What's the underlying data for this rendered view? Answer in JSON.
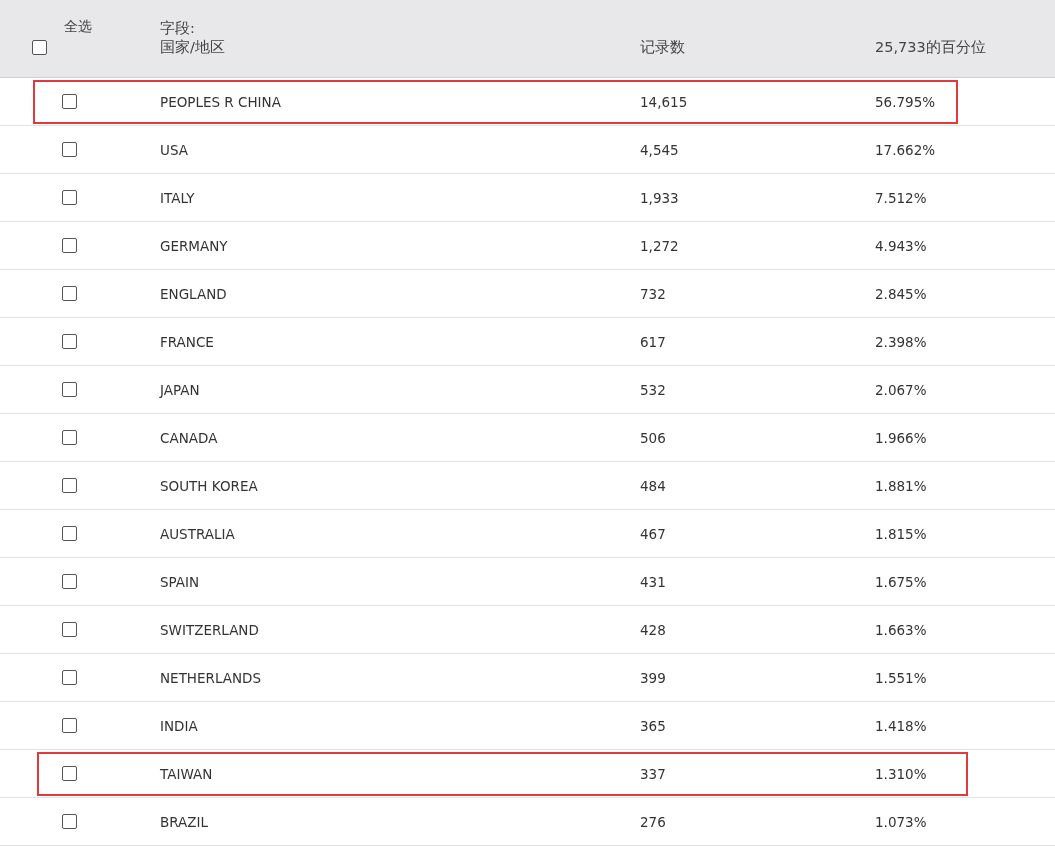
{
  "header": {
    "select_all": {
      "label": "全选",
      "checked": false
    },
    "field_label": "字段:",
    "columns": [
      "国家/地区",
      "记录数",
      "25,733的百分位"
    ]
  },
  "rows": [
    {
      "country": "PEOPLES R CHINA",
      "records": "14,615",
      "percent": "56.795%",
      "checked": false,
      "highlighted": true
    },
    {
      "country": "USA",
      "records": "4,545",
      "percent": "17.662%",
      "checked": false,
      "highlighted": false
    },
    {
      "country": "ITALY",
      "records": "1,933",
      "percent": "7.512%",
      "checked": false,
      "highlighted": false
    },
    {
      "country": "GERMANY",
      "records": "1,272",
      "percent": "4.943%",
      "checked": false,
      "highlighted": false
    },
    {
      "country": "ENGLAND",
      "records": "732",
      "percent": "2.845%",
      "checked": false,
      "highlighted": false
    },
    {
      "country": "FRANCE",
      "records": "617",
      "percent": "2.398%",
      "checked": false,
      "highlighted": false
    },
    {
      "country": "JAPAN",
      "records": "532",
      "percent": "2.067%",
      "checked": false,
      "highlighted": false
    },
    {
      "country": "CANADA",
      "records": "506",
      "percent": "1.966%",
      "checked": false,
      "highlighted": false
    },
    {
      "country": "SOUTH KOREA",
      "records": "484",
      "percent": "1.881%",
      "checked": false,
      "highlighted": false
    },
    {
      "country": "AUSTRALIA",
      "records": "467",
      "percent": "1.815%",
      "checked": false,
      "highlighted": false
    },
    {
      "country": "SPAIN",
      "records": "431",
      "percent": "1.675%",
      "checked": false,
      "highlighted": false
    },
    {
      "country": "SWITZERLAND",
      "records": "428",
      "percent": "1.663%",
      "checked": false,
      "highlighted": false
    },
    {
      "country": "NETHERLANDS",
      "records": "399",
      "percent": "1.551%",
      "checked": false,
      "highlighted": false
    },
    {
      "country": "INDIA",
      "records": "365",
      "percent": "1.418%",
      "checked": false,
      "highlighted": false
    },
    {
      "country": "TAIWAN",
      "records": "337",
      "percent": "1.310%",
      "checked": false,
      "highlighted": true
    },
    {
      "country": "BRAZIL",
      "records": "276",
      "percent": "1.073%",
      "checked": false,
      "highlighted": false
    }
  ]
}
